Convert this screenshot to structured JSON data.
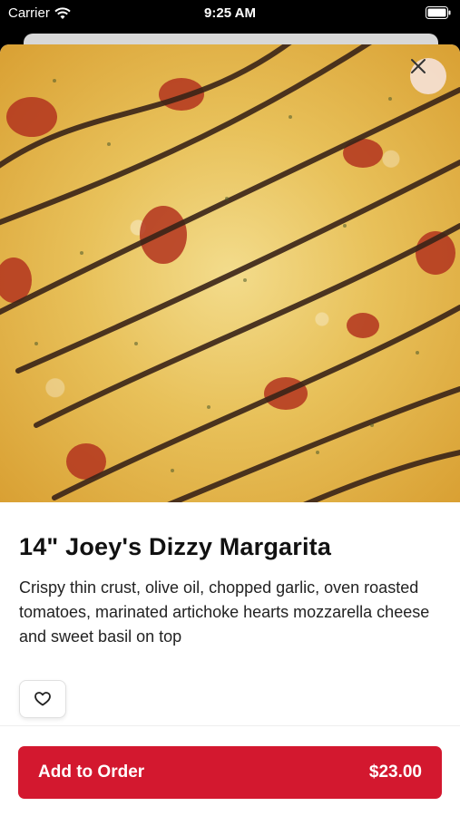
{
  "status_bar": {
    "carrier": "Carrier",
    "time": "9:25 AM",
    "wifi_icon": "wifi-icon",
    "battery_icon": "battery-icon"
  },
  "item": {
    "image_alt": "pizza-photo",
    "title": "14\" Joey's Dizzy Margarita",
    "description": "Crispy thin crust, olive oil, chopped garlic, oven roasted tomatoes, marinated artichoke hearts mozzarella cheese and sweet basil on top"
  },
  "actions": {
    "close_icon": "close-icon",
    "favorite_icon": "heart-icon"
  },
  "order_button": {
    "label": "Add to Order",
    "price": "$23.00"
  },
  "colors": {
    "accent": "#d3182f",
    "background": "#ffffff",
    "close_button_bg": "#f5e1d7"
  }
}
